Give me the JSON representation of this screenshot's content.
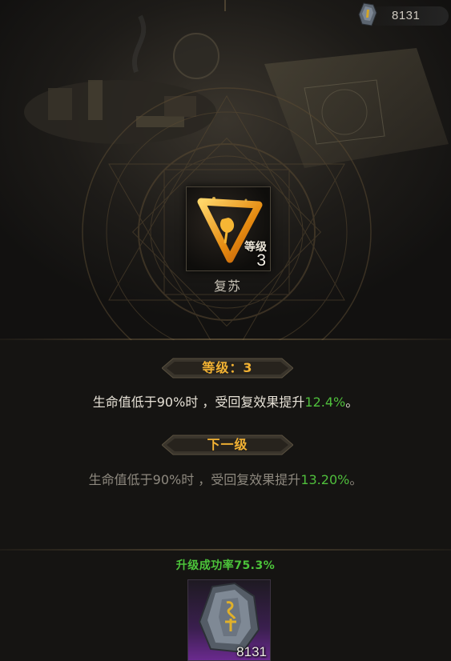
{
  "currency": {
    "icon": "rune-stone-icon",
    "amount": "8131"
  },
  "skill": {
    "icon": "revive-triangle-icon",
    "level_caption": "等级",
    "level_value": "3",
    "name": "复苏"
  },
  "current_level": {
    "banner": "等级：3",
    "description_prefix": "生命值低于90%时 ，受回复效果提升",
    "description_value": "12.4%",
    "description_suffix": "。"
  },
  "next_level": {
    "banner": "下一级",
    "description_prefix": "生命值低于90%时 ，受回复效果提升",
    "description_value": "13.20%",
    "description_suffix": "。"
  },
  "upgrade": {
    "success_rate": "升级成功率75.3%",
    "material_icon": "rune-stone-icon",
    "material_count": "8131"
  },
  "colors": {
    "accent_gold": "#f2b233",
    "highlight_green": "#4fbf3c",
    "material_purple": "#6a2a8e"
  }
}
